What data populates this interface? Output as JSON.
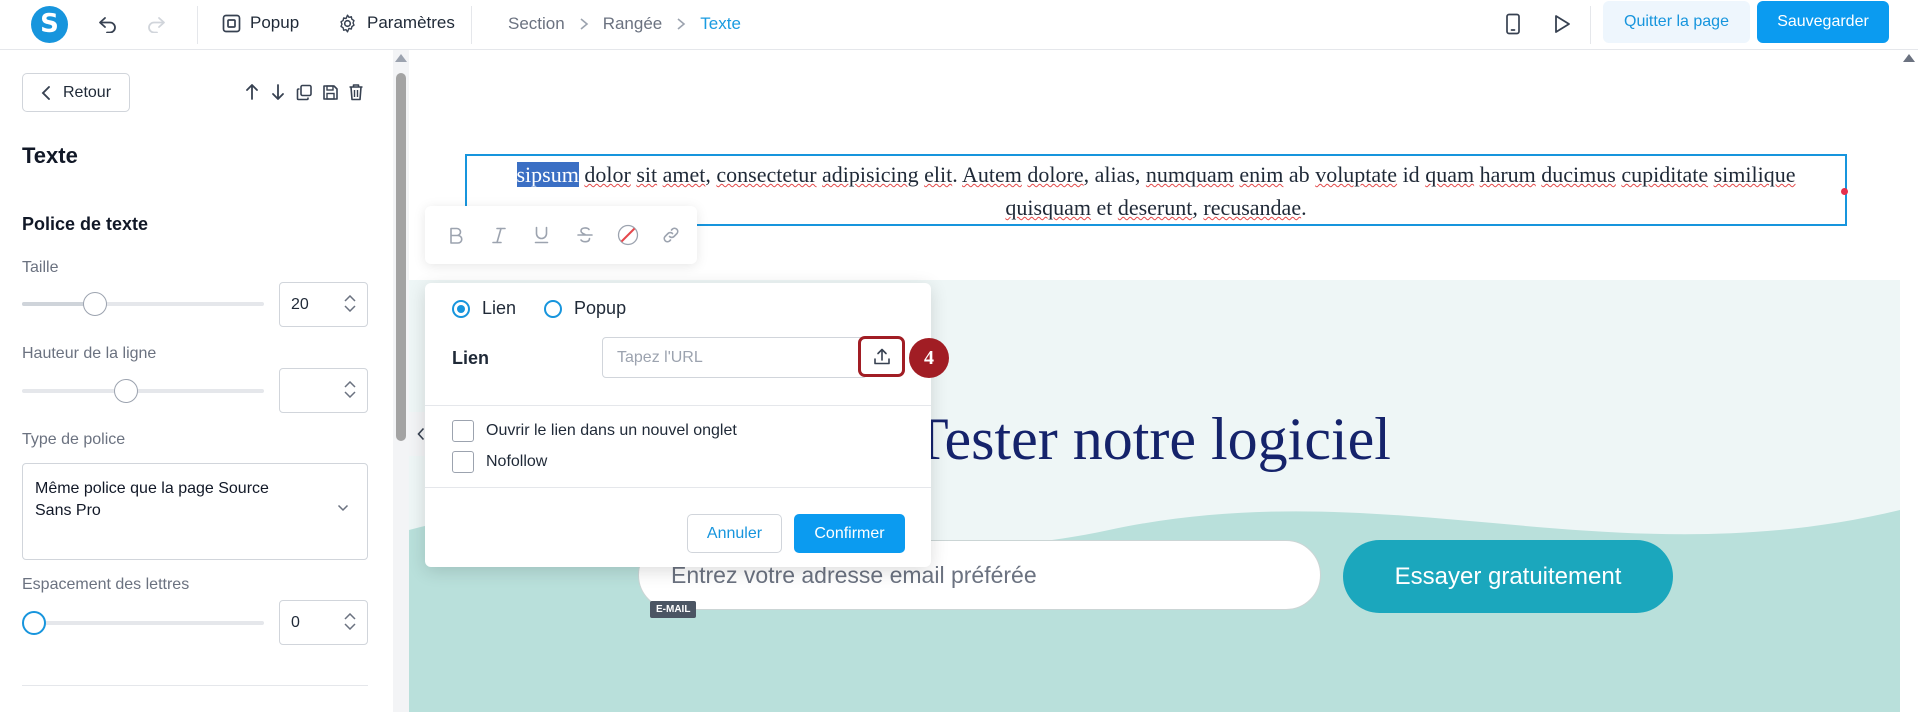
{
  "topbar": {
    "logo_letter": "S",
    "popup_label": "Popup",
    "settings_label": "Paramètres",
    "breadcrumb": [
      "Section",
      "Rangée",
      "Texte"
    ],
    "quit_label": "Quitter la page",
    "save_label": "Sauvegarder"
  },
  "panel": {
    "back_label": "Retour",
    "title": "Texte",
    "font_section_title": "Police de texte",
    "size_label": "Taille",
    "size_value": "20",
    "size_slider_fraction": 0.28,
    "line_height_label": "Hauteur de la ligne",
    "line_height_value": "",
    "line_height_slider_fraction": 0.42,
    "font_type_label": "Type de police",
    "font_type_value": "Même police que la page Source Sans Pro",
    "letter_spacing_label": "Espacement des lettres",
    "letter_spacing_value": "0",
    "letter_spacing_slider_fraction": 0.0
  },
  "canvas": {
    "text_selected": "sipsum",
    "text_line1_rest": [
      {
        "t": " ",
        "u": false
      },
      {
        "t": "dolor",
        "u": true
      },
      {
        "t": " ",
        "u": false
      },
      {
        "t": "sit",
        "u": true
      },
      {
        "t": " ",
        "u": false
      },
      {
        "t": "amet",
        "u": true
      },
      {
        "t": ", ",
        "u": false
      },
      {
        "t": "consectetur",
        "u": true
      },
      {
        "t": " ",
        "u": false
      },
      {
        "t": "adipisicing",
        "u": true
      },
      {
        "t": " ",
        "u": false
      },
      {
        "t": "elit",
        "u": true
      },
      {
        "t": ". ",
        "u": false
      },
      {
        "t": "Autem",
        "u": true
      },
      {
        "t": " ",
        "u": false
      },
      {
        "t": "dolore",
        "u": true
      },
      {
        "t": ", alias, ",
        "u": false
      },
      {
        "t": "numquam",
        "u": true
      },
      {
        "t": " ",
        "u": false
      },
      {
        "t": "enim",
        "u": true
      },
      {
        "t": " ab ",
        "u": false
      },
      {
        "t": "voluptate",
        "u": true
      },
      {
        "t": " id ",
        "u": false
      },
      {
        "t": "quam",
        "u": true
      },
      {
        "t": " ",
        "u": false
      },
      {
        "t": "harum",
        "u": true
      },
      {
        "t": " ",
        "u": false
      },
      {
        "t": "ducimus",
        "u": true
      },
      {
        "t": " ",
        "u": false
      },
      {
        "t": "cupiditate",
        "u": true
      },
      {
        "t": " ",
        "u": false
      },
      {
        "t": "similique",
        "u": true
      }
    ],
    "text_line2": [
      {
        "t": "quisquam",
        "u": true
      },
      {
        "t": " et ",
        "u": false
      },
      {
        "t": "deserunt",
        "u": true
      },
      {
        "t": ", ",
        "u": false
      },
      {
        "t": "recusandae",
        "u": true
      },
      {
        "t": ".",
        "u": false
      }
    ],
    "headline": "Tester notre logiciel",
    "email_placeholder": "Entrez votre adresse email préférée",
    "email_tag": "E-MAIL",
    "cta_label": "Essayer gratuitement"
  },
  "format_toolbar": {
    "icons": [
      "bold-icon",
      "italic-icon",
      "underline-icon",
      "strikethrough-icon",
      "clear-color-icon",
      "link-icon"
    ]
  },
  "link_popover": {
    "radio_link": "Lien",
    "radio_popup": "Popup",
    "link_field_label": "Lien",
    "url_placeholder": "Tapez l'URL",
    "step_badge": "4",
    "checkbox_new_tab": "Ouvrir le lien dans un nouvel onglet",
    "checkbox_nofollow": "Nofollow",
    "cancel_label": "Annuler",
    "confirm_label": "Confirmer"
  },
  "colors": {
    "accent": "#1795dd",
    "primary_button": "#0b9bf0",
    "highlight": "#a11d24",
    "headline": "#15236b",
    "cta": "#1ba7bd"
  }
}
